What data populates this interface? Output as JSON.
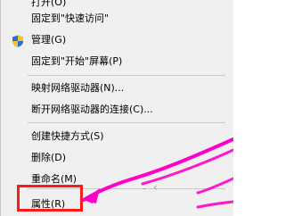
{
  "context_menu": {
    "items": [
      {
        "label": "打开(O)"
      },
      {
        "label": "固定到\"快速访问\""
      },
      {
        "label": "管理(G)",
        "icon": "uac-shield-icon"
      },
      {
        "label": "固定到\"开始\"屏幕(P)"
      },
      {
        "label": "映射网络驱动器(N)..."
      },
      {
        "label": "断开网络驱动器的连接(C)..."
      },
      {
        "label": "创建快捷方式(S)"
      },
      {
        "label": "删除(D)"
      },
      {
        "label": "重命名(M)"
      },
      {
        "label": "属性(R)"
      }
    ]
  },
  "annotation": {
    "highlight_color": "#ff1a1a",
    "arrow_color": "#ff00cc",
    "highlighted_item": "属性(R)"
  }
}
